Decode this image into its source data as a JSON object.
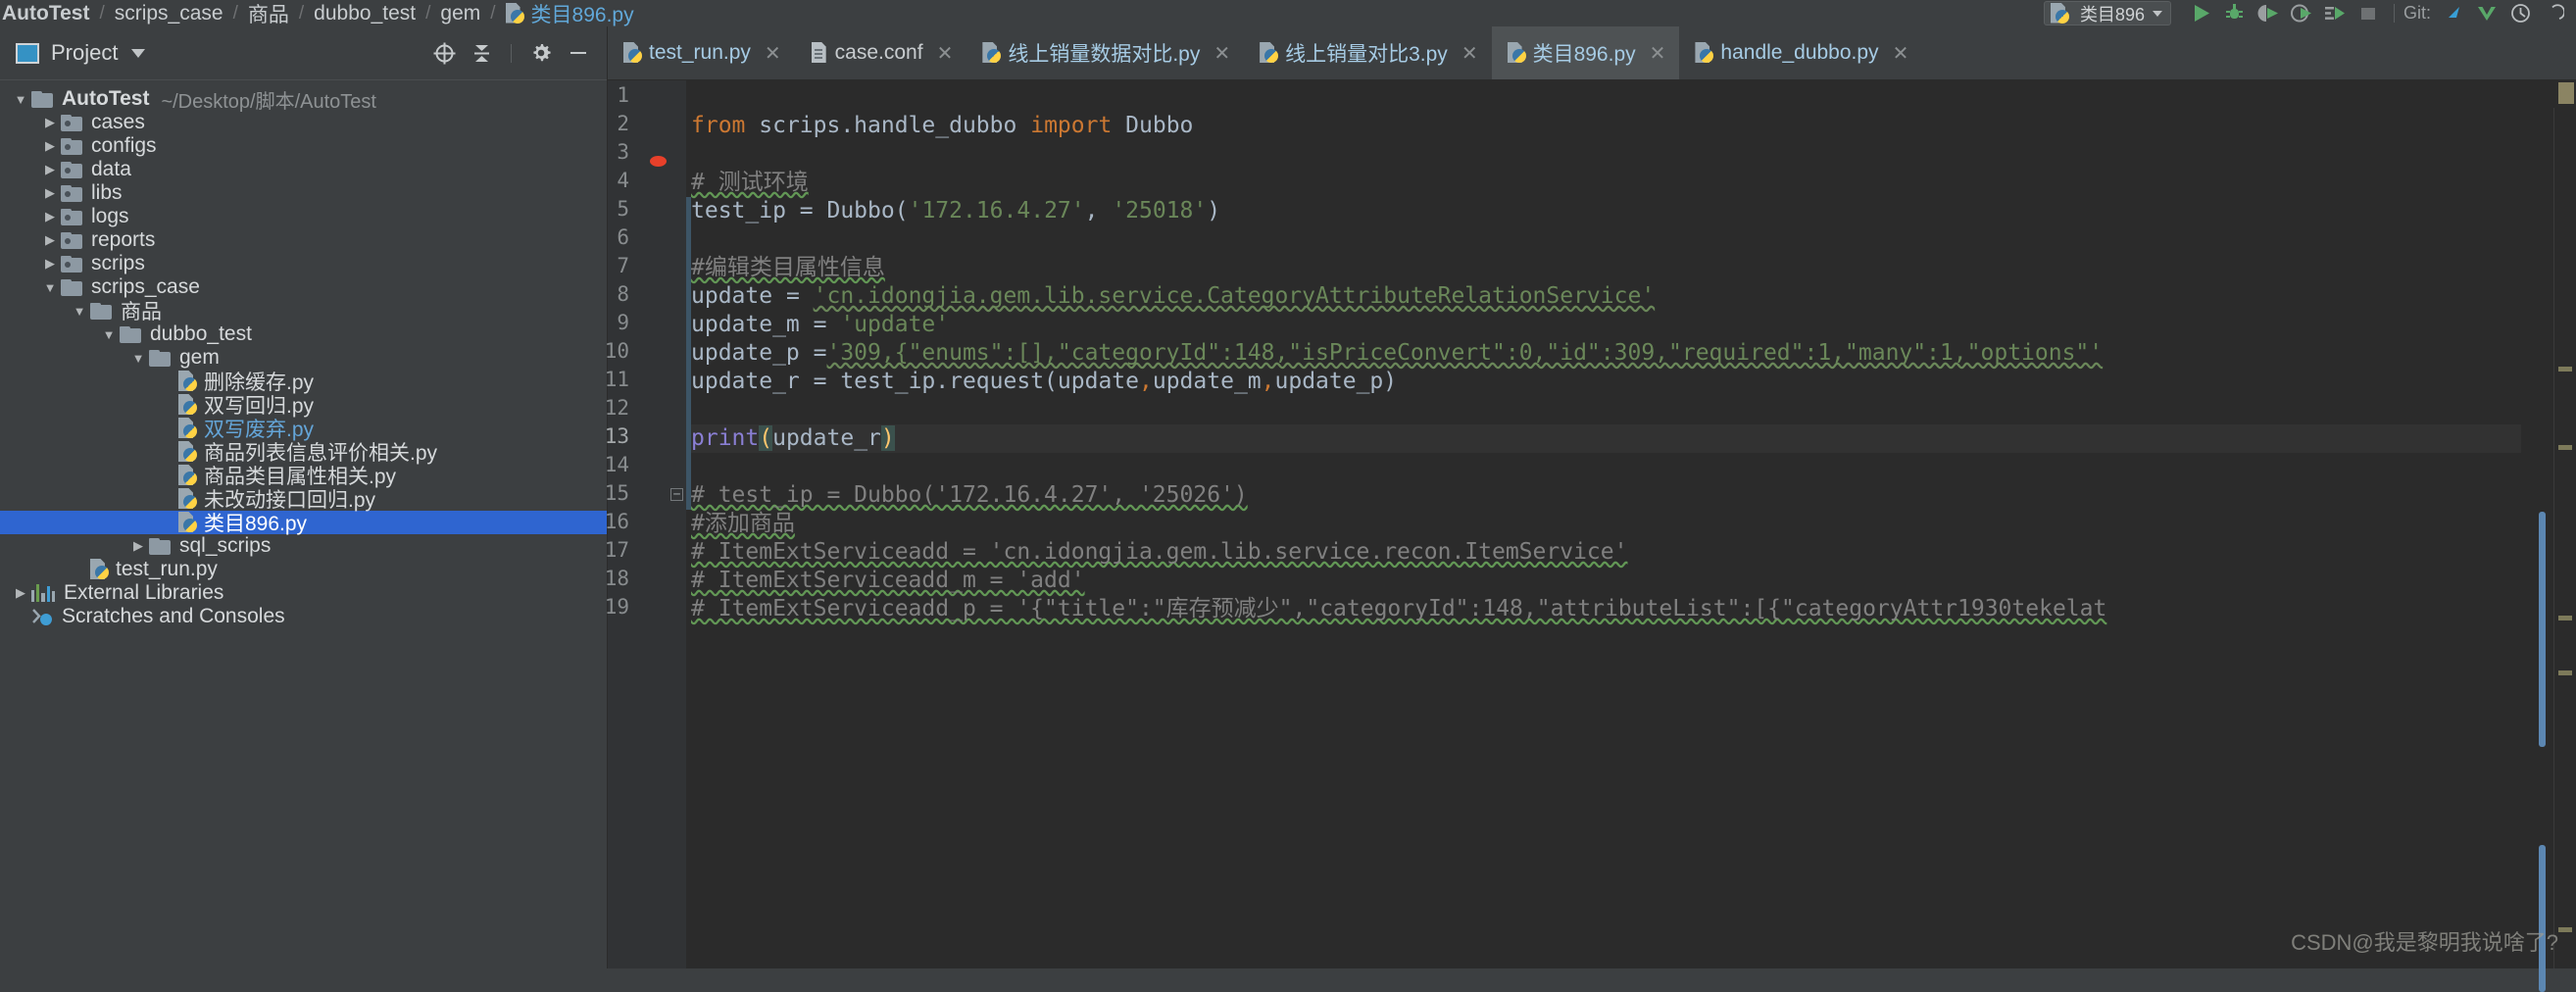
{
  "breadcrumb": {
    "items": [
      {
        "label": "AutoTest",
        "kind": "project"
      },
      {
        "label": "scrips_case",
        "kind": "folder"
      },
      {
        "label": "商品",
        "kind": "folder"
      },
      {
        "label": "dubbo_test",
        "kind": "folder"
      },
      {
        "label": "gem",
        "kind": "folder"
      },
      {
        "label": "类目896.py",
        "kind": "pyfile"
      }
    ],
    "separator": "/"
  },
  "toolbar": {
    "run_config_label": "类目896",
    "git_label": "Git:",
    "buttons": [
      {
        "name": "run-button",
        "icon": "play-icon"
      },
      {
        "name": "debug-button",
        "icon": "bug-icon"
      },
      {
        "name": "run-coverage-button",
        "icon": "coverage-icon"
      },
      {
        "name": "profile-button",
        "icon": "profile-icon"
      },
      {
        "name": "run-with-console-button",
        "icon": "run-console-icon"
      },
      {
        "name": "stop-button",
        "icon": "stop-icon"
      },
      {
        "name": "git-update-button",
        "icon": "update-project-icon"
      },
      {
        "name": "git-commit-button",
        "icon": "commit-check-icon"
      },
      {
        "name": "git-history-button",
        "icon": "history-clock-icon"
      },
      {
        "name": "git-rollback-button",
        "icon": "rollback-icon"
      }
    ]
  },
  "project_panel": {
    "title": "Project",
    "header_buttons": [
      {
        "name": "scroll-from-source-button",
        "icon": "target-icon"
      },
      {
        "name": "collapse-all-button",
        "icon": "collapse-all-icon"
      },
      {
        "name": "settings-button",
        "icon": "gear-icon"
      },
      {
        "name": "hide-button",
        "icon": "minimize-icon"
      }
    ],
    "tree": [
      {
        "label": "AutoTest",
        "hint": "~/Desktop/脚本/AutoTest",
        "indent": 0,
        "arrow": "down",
        "icon": "folder",
        "bold": true
      },
      {
        "label": "cases",
        "indent": 1,
        "arrow": "right",
        "icon": "source-folder"
      },
      {
        "label": "configs",
        "indent": 1,
        "arrow": "right",
        "icon": "source-folder"
      },
      {
        "label": "data",
        "indent": 1,
        "arrow": "right",
        "icon": "source-folder"
      },
      {
        "label": "libs",
        "indent": 1,
        "arrow": "right",
        "icon": "source-folder"
      },
      {
        "label": "logs",
        "indent": 1,
        "arrow": "right",
        "icon": "source-folder"
      },
      {
        "label": "reports",
        "indent": 1,
        "arrow": "right",
        "icon": "source-folder"
      },
      {
        "label": "scrips",
        "indent": 1,
        "arrow": "right",
        "icon": "source-folder"
      },
      {
        "label": "scrips_case",
        "indent": 1,
        "arrow": "down",
        "icon": "folder"
      },
      {
        "label": "商品",
        "indent": 2,
        "arrow": "down",
        "icon": "folder"
      },
      {
        "label": "dubbo_test",
        "indent": 3,
        "arrow": "down",
        "icon": "folder"
      },
      {
        "label": "gem",
        "indent": 4,
        "arrow": "down",
        "icon": "folder"
      },
      {
        "label": "删除缓存.py",
        "indent": 5,
        "arrow": "none",
        "icon": "pyfile"
      },
      {
        "label": "双写回归.py",
        "indent": 5,
        "arrow": "none",
        "icon": "pyfile"
      },
      {
        "label": "双写废弃.py",
        "indent": 5,
        "arrow": "none",
        "icon": "pyfile",
        "color": "blue"
      },
      {
        "label": "商品列表信息评价相关.py",
        "indent": 5,
        "arrow": "none",
        "icon": "pyfile"
      },
      {
        "label": "商品类目属性相关.py",
        "indent": 5,
        "arrow": "none",
        "icon": "pyfile"
      },
      {
        "label": "未改动接口回归.py",
        "indent": 5,
        "arrow": "none",
        "icon": "pyfile"
      },
      {
        "label": "类目896.py",
        "indent": 5,
        "arrow": "none",
        "icon": "pyfile",
        "selected": true
      },
      {
        "label": "sql_scrips",
        "indent": 4,
        "arrow": "right",
        "icon": "folder"
      },
      {
        "label": "test_run.py",
        "indent": 2,
        "arrow": "none",
        "icon": "pyfile"
      },
      {
        "label": "External Libraries",
        "indent": 0,
        "arrow": "right",
        "icon": "libraries"
      },
      {
        "label": "Scratches and Consoles",
        "indent": 0,
        "arrow": "none",
        "icon": "scratches"
      }
    ]
  },
  "editor": {
    "tabs": [
      {
        "label": "test_run.py",
        "icon": "pyfile",
        "active": false,
        "close": "✕"
      },
      {
        "label": "case.conf",
        "icon": "conf-file",
        "active": false,
        "close": "✕"
      },
      {
        "label": "线上销量数据对比.py",
        "icon": "pyfile",
        "active": false,
        "close": "✕"
      },
      {
        "label": "线上销量对比3.py",
        "icon": "pyfile",
        "active": false,
        "close": "✕"
      },
      {
        "label": "类目896.py",
        "icon": "pyfile",
        "active": true,
        "close": "✕"
      },
      {
        "label": "handle_dubbo.py",
        "icon": "pyfile",
        "active": false,
        "close": "✕"
      }
    ],
    "line_numbers": [
      "1",
      "2",
      "3",
      "4",
      "5",
      "6",
      "7",
      "8",
      "9",
      "10",
      "11",
      "12",
      "13",
      "14",
      "15",
      "16",
      "17",
      "18",
      "19"
    ],
    "current_line": 13,
    "breakpoint_line": 3,
    "fold_marker_line": 15,
    "fold_marker_glyph": "−",
    "lines": [
      {
        "n": 1,
        "text": ""
      },
      {
        "n": 2,
        "text": "from scrips.handle_dubbo import Dubbo"
      },
      {
        "n": 3,
        "text": ""
      },
      {
        "n": 4,
        "text": "# 测试环境"
      },
      {
        "n": 5,
        "text": "test_ip = Dubbo('172.16.4.27', '25018')"
      },
      {
        "n": 6,
        "text": ""
      },
      {
        "n": 7,
        "text": "#编辑类目属性信息"
      },
      {
        "n": 8,
        "text": "update = 'cn.idongjia.gem.lib.service.CategoryAttributeRelationService'"
      },
      {
        "n": 9,
        "text": "update_m = 'update'"
      },
      {
        "n": 10,
        "text": "update_p ='309,{\"enums\":[],\"categoryId\":148,\"isPriceConvert\":0,\"id\":309,\"required\":1,\"many\":1,\"options\"'"
      },
      {
        "n": 11,
        "text": "update_r = test_ip.request(update,update_m,update_p)"
      },
      {
        "n": 12,
        "text": ""
      },
      {
        "n": 13,
        "text": "print(update_r)"
      },
      {
        "n": 14,
        "text": ""
      },
      {
        "n": 15,
        "text": "# test_ip = Dubbo('172.16.4.27', '25026')"
      },
      {
        "n": 16,
        "text": "#添加商品"
      },
      {
        "n": 17,
        "text": "# ItemExtServiceadd = 'cn.idongjia.gem.lib.service.recon.ItemService'"
      },
      {
        "n": 18,
        "text": "# ItemExtServiceadd_m = 'add'"
      },
      {
        "n": 19,
        "text": "# ItemExtServiceadd_p = '{\"title\":\"库存预减少\",\"categoryId\":148,\"attributeList\":[{\"categoryAttr1930tekelat"
      }
    ]
  },
  "watermark": "CSDN@我是黎明我说啥了?",
  "colors": {
    "editor_bg": "#2b2b2b",
    "panel_bg": "#3c3f41",
    "gutter_bg": "#313335",
    "selection_blue": "#2f65d0",
    "keyword_orange": "#cc7832",
    "string_green": "#6a8759",
    "number_blue": "#6897bb",
    "comment_gray": "#808080",
    "default_text": "#a9b7c6",
    "function_purple": "#8a7fd4",
    "breakpoint_red": "#e8402a",
    "link_blue": "#64a5d8"
  }
}
